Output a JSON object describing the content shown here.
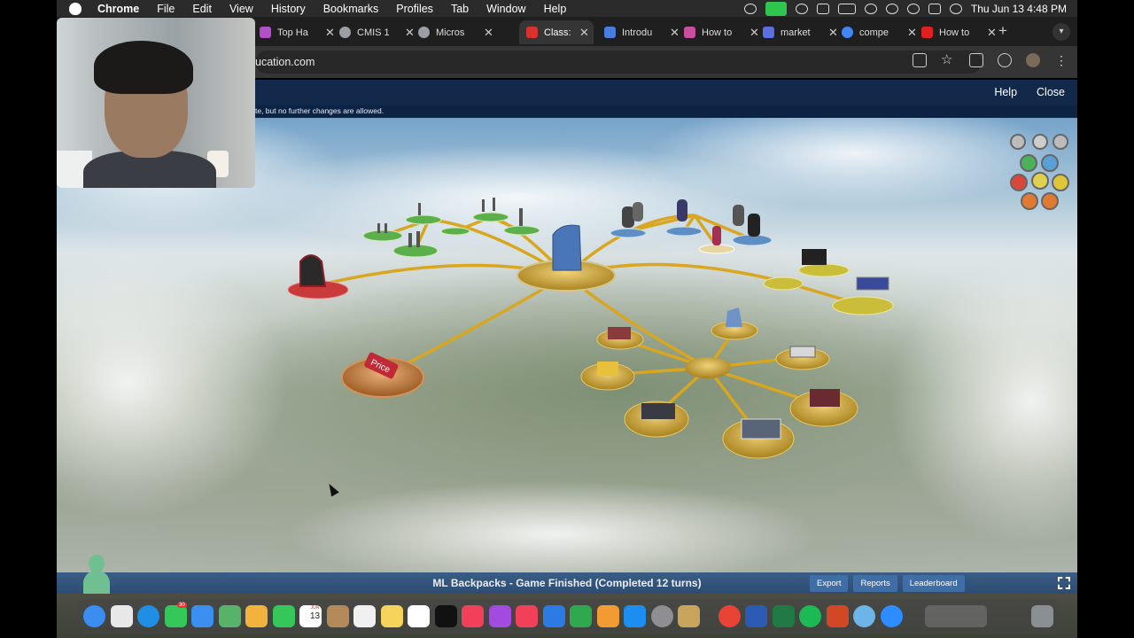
{
  "menubar": {
    "app": "Chrome",
    "items": [
      "File",
      "Edit",
      "View",
      "History",
      "Bookmarks",
      "Profiles",
      "Tab",
      "Window",
      "Help"
    ],
    "datetime": "Thu Jun 13  4:48 PM"
  },
  "tabs": [
    {
      "title": "Top Ha",
      "color": "#b34fc9",
      "active": false
    },
    {
      "title": "CMIS 1",
      "color": "#9aa0a6",
      "active": false
    },
    {
      "title": "Micros",
      "color": "#9aa0a6",
      "active": false
    },
    {
      "title": "Class: ",
      "color": "#d93030",
      "active": true
    },
    {
      "title": "Introdu",
      "color": "#4a7de0",
      "active": false
    },
    {
      "title": "How to",
      "color": "#c84fa0",
      "active": false
    },
    {
      "title": "market",
      "color": "#5b70e0",
      "active": false
    },
    {
      "title": "compe",
      "color": "#4285f4",
      "active": false
    },
    {
      "title": "How to",
      "color": "#e02020",
      "active": false
    }
  ],
  "address": {
    "url": "ucation.com"
  },
  "app_header": {
    "help": "Help",
    "close": "Close"
  },
  "notice": "te, but no further changes are allowed.",
  "scene": {
    "hub_label": "",
    "price_tag": "Price"
  },
  "status": {
    "title": "ML Backpacks - Game Finished (Completed 12 turns)",
    "buttons": [
      "Export",
      "Reports",
      "Leaderboard"
    ]
  },
  "dock": {
    "apps": [
      {
        "name": "finder",
        "color": "#3a8ef0"
      },
      {
        "name": "launchpad",
        "color": "#e8e8e8"
      },
      {
        "name": "safari",
        "color": "#1f8fe6"
      },
      {
        "name": "messages",
        "color": "#35c759"
      },
      {
        "name": "mail",
        "color": "#3b8ff0"
      },
      {
        "name": "maps",
        "color": "#58b36a"
      },
      {
        "name": "photos",
        "color": "#f2b33d"
      },
      {
        "name": "facetime",
        "color": "#35c759"
      },
      {
        "name": "calendar",
        "color": "#ffffff"
      },
      {
        "name": "contacts",
        "color": "#b58a5a"
      },
      {
        "name": "reminders",
        "color": "#f0f0f0"
      },
      {
        "name": "notes",
        "color": "#f6d35a"
      },
      {
        "name": "freeform",
        "color": "#ffffff"
      },
      {
        "name": "tv",
        "color": "#111111"
      },
      {
        "name": "music",
        "color": "#f2405a"
      },
      {
        "name": "podcasts",
        "color": "#a34be0"
      },
      {
        "name": "news",
        "color": "#f2405a"
      },
      {
        "name": "keynote",
        "color": "#2c7be5"
      },
      {
        "name": "numbers",
        "color": "#2fa84f"
      },
      {
        "name": "pages",
        "color": "#f29b32"
      },
      {
        "name": "app-store",
        "color": "#1c8ef0"
      },
      {
        "name": "system-settings",
        "color": "#8e8e93"
      },
      {
        "name": "league",
        "color": "#c9a45c"
      },
      {
        "name": "chrome",
        "color": "#ea4335"
      },
      {
        "name": "word",
        "color": "#2b5bb5"
      },
      {
        "name": "excel",
        "color": "#1f7a45"
      },
      {
        "name": "spotify",
        "color": "#1db954"
      },
      {
        "name": "powerpoint",
        "color": "#d24726"
      },
      {
        "name": "preview",
        "color": "#6cb5e8"
      },
      {
        "name": "zoom",
        "color": "#2d8cff"
      }
    ],
    "calendar_day": "13",
    "calendar_month": "JUN",
    "messages_badge": "30"
  }
}
